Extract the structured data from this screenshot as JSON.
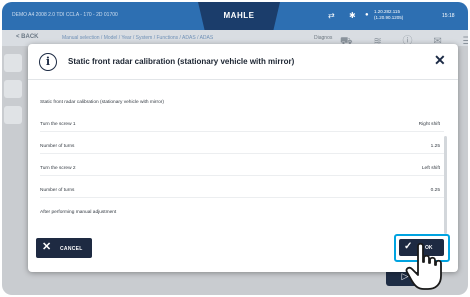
{
  "status_bar": {
    "vehicle": "DEMO A4 2008 2.0 TDI CCLA - 170 - 2D 01700",
    "brand": "MAHLE",
    "vcc_line1": "1.20.282.115",
    "vcc_line2": "(1.20.90.1205)",
    "time": "15:18"
  },
  "nav": {
    "back_label": "< BACK",
    "breadcrumb": "Manual selection  /  Model  /  Year  /  System  /  Functions  /  ADAS  /  ADAS",
    "diag_label": "Diagnos"
  },
  "background": {
    "next_icon": "play-icon"
  },
  "dialog": {
    "title": "Static front radar calibration (stationary vehicle with mirror)",
    "intro": "Static front radar calibration (stationary vehicle with mirror)",
    "rows": [
      {
        "label": "Turn the screw 1",
        "value": "Right shift"
      },
      {
        "label": "Number of turns",
        "value": "1.25"
      },
      {
        "label": "Turn the screw 2",
        "value": "Left shift"
      },
      {
        "label": "Number of turns",
        "value": "0.25"
      },
      {
        "label": "After performing manual adjustment",
        "value": ""
      }
    ],
    "cancel_label": "CANCEL",
    "ok_label": "OK"
  },
  "colors": {
    "status_bar": "#2d6fb2",
    "brand_tab": "#1b3d6b",
    "button": "#1e2a42",
    "ok_highlight": "#00a3e0"
  }
}
